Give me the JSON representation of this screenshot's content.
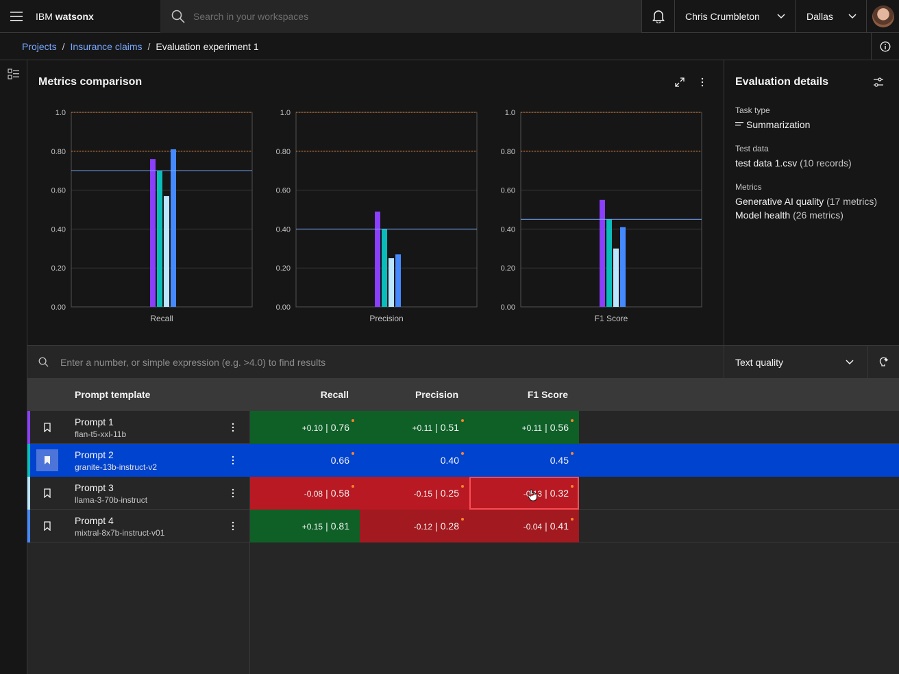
{
  "header": {
    "brand_prefix": "IBM",
    "brand_name": "watsonx",
    "search_placeholder": "Search in your workspaces",
    "user_name": "Chris Crumbleton",
    "region": "Dallas",
    "icons": [
      "menu-icon",
      "search-icon",
      "notification-icon",
      "chevron-down-icon",
      "avatar"
    ]
  },
  "breadcrumb": {
    "items": [
      "Projects",
      "Insurance claims"
    ],
    "separator": "/",
    "current": "Evaluation experiment 1"
  },
  "metrics": {
    "title": "Metrics comparison"
  },
  "details": {
    "title": "Evaluation details",
    "task_type_label": "Task type",
    "task_type_value": "Summarization",
    "test_data_label": "Test data",
    "test_data_value": "test data 1.csv",
    "test_data_count": "(10 records)",
    "metrics_label": "Metrics",
    "metric1_name": "Generative AI quality",
    "metric1_count": "(17 metrics)",
    "metric2_name": "Model health",
    "metric2_count": "(26 metrics)"
  },
  "filter": {
    "placeholder": "Enter a number, or simple expression (e.g. >4.0) to find results",
    "dropdown_value": "Text quality"
  },
  "table": {
    "headers": {
      "template": "Prompt template",
      "recall": "Recall",
      "precision": "Precision",
      "f1": "F1 Score"
    },
    "rows": [
      {
        "name": "Prompt 1",
        "model": "flan-t5-xxl-11b",
        "recall_delta": "+0.10",
        "recall": "0.76",
        "precision_delta": "+0.11",
        "precision": "0.51",
        "f1_delta": "+0.11",
        "f1": "0.56",
        "color": "#8a3ffc"
      },
      {
        "name": "Prompt 2",
        "model": "granite-13b-instruct-v2",
        "recall_delta": "",
        "recall": "0.66",
        "precision_delta": "",
        "precision": "0.40",
        "f1_delta": "",
        "f1": "0.45",
        "color": "#08bdba"
      },
      {
        "name": "Prompt 3",
        "model": "llama-3-70b-instruct",
        "recall_delta": "-0.08",
        "recall": "0.58",
        "precision_delta": "-0.15",
        "precision": "0.25",
        "f1_delta": "-0.13",
        "f1": "0.32",
        "color": "#bae6ff"
      },
      {
        "name": "Prompt 4",
        "model": "mixtral-8x7b-instruct-v01",
        "recall_delta": "+0.15",
        "recall": "0.81",
        "precision_delta": "-0.12",
        "precision": "0.28",
        "f1_delta": "-0.04",
        "f1": "0.41",
        "color": "#4589ff"
      }
    ],
    "separator": "|"
  },
  "chart_data": [
    {
      "type": "bar",
      "xlabel": "Recall",
      "ylim": [
        0,
        1.0
      ],
      "yticks": [
        "0.00",
        "0.20",
        "0.40",
        "0.60",
        "0.80",
        "1.0"
      ],
      "series": [
        {
          "values": [
            0.76
          ],
          "color": "#8a3ffc"
        },
        {
          "values": [
            0.7
          ],
          "color": "#08bdba"
        },
        {
          "values": [
            0.57
          ],
          "color": "#bae6ff"
        },
        {
          "values": [
            0.81
          ],
          "color": "#4589ff"
        }
      ],
      "threshold_lines": [
        1.0,
        0.8
      ],
      "baseline": 0.7
    },
    {
      "type": "bar",
      "xlabel": "Precision",
      "ylim": [
        0,
        1.0
      ],
      "yticks": [
        "0.00",
        "0.20",
        "0.40",
        "0.60",
        "0.80",
        "1.0"
      ],
      "series": [
        {
          "values": [
            0.49
          ],
          "color": "#8a3ffc"
        },
        {
          "values": [
            0.4
          ],
          "color": "#08bdba"
        },
        {
          "values": [
            0.25
          ],
          "color": "#bae6ff"
        },
        {
          "values": [
            0.27
          ],
          "color": "#4589ff"
        }
      ],
      "threshold_lines": [
        1.0,
        0.8
      ],
      "baseline": 0.4
    },
    {
      "type": "bar",
      "xlabel": "F1 Score",
      "ylim": [
        0,
        1.0
      ],
      "yticks": [
        "0.00",
        "0.20",
        "0.40",
        "0.60",
        "0.80",
        "1.0"
      ],
      "series": [
        {
          "values": [
            0.55
          ],
          "color": "#8a3ffc"
        },
        {
          "values": [
            0.45
          ],
          "color": "#08bdba"
        },
        {
          "values": [
            0.3
          ],
          "color": "#bae6ff"
        },
        {
          "values": [
            0.41
          ],
          "color": "#4589ff"
        }
      ],
      "threshold_lines": [
        1.0,
        0.8
      ],
      "baseline": 0.45
    }
  ]
}
